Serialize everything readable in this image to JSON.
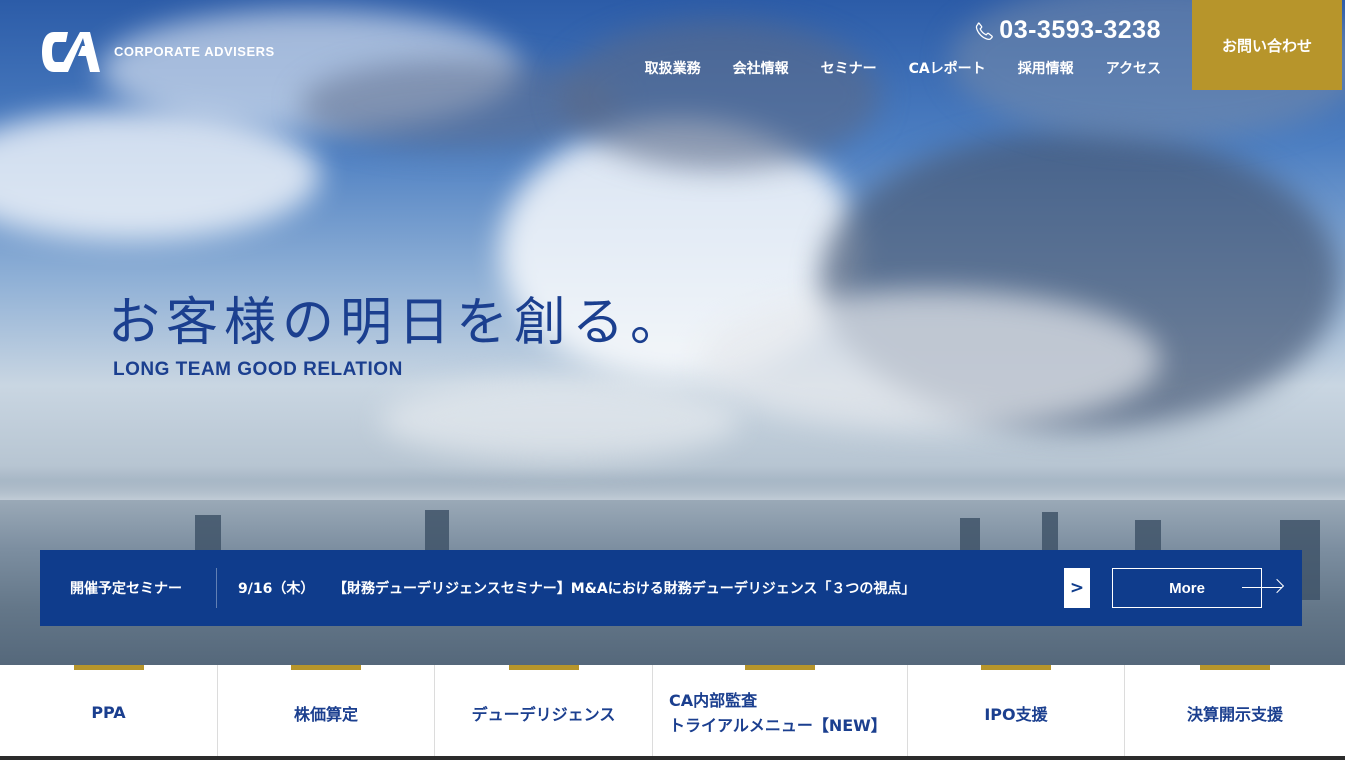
{
  "brand": {
    "name": "CORPORATE ADVISERS"
  },
  "header": {
    "phone": "03-3593-3238",
    "nav": [
      "取扱業務",
      "会社情報",
      "セミナー",
      "CAレポート",
      "採用情報",
      "アクセス"
    ],
    "contact_label": "お問い合わせ"
  },
  "hero": {
    "catch": "お客様の明日を創る。",
    "sub": "LONG TEAM GOOD RELATION"
  },
  "seminar": {
    "label": "開催予定セミナー",
    "date": "9/16（木）",
    "title": "【財務デューデリジェンスセミナー】M&Aにおける財務デューデリジェンス「３つの視点」",
    "more_label": "More"
  },
  "services": [
    {
      "label": "PPA"
    },
    {
      "label": "株価算定"
    },
    {
      "label": "デューデリジェンス"
    },
    {
      "label": "CA内部監査",
      "label2": "トライアルメニュー【NEW】"
    },
    {
      "label": "IPO支援"
    },
    {
      "label": "決算開示支援"
    }
  ],
  "colors": {
    "navy": "#0f3c8c",
    "gold": "#b7952b",
    "text_blue": "#1b3f8f"
  },
  "icons": [
    "ca-logo-icon",
    "phone-icon",
    "chevron-right-icon",
    "arrow-right-icon"
  ]
}
